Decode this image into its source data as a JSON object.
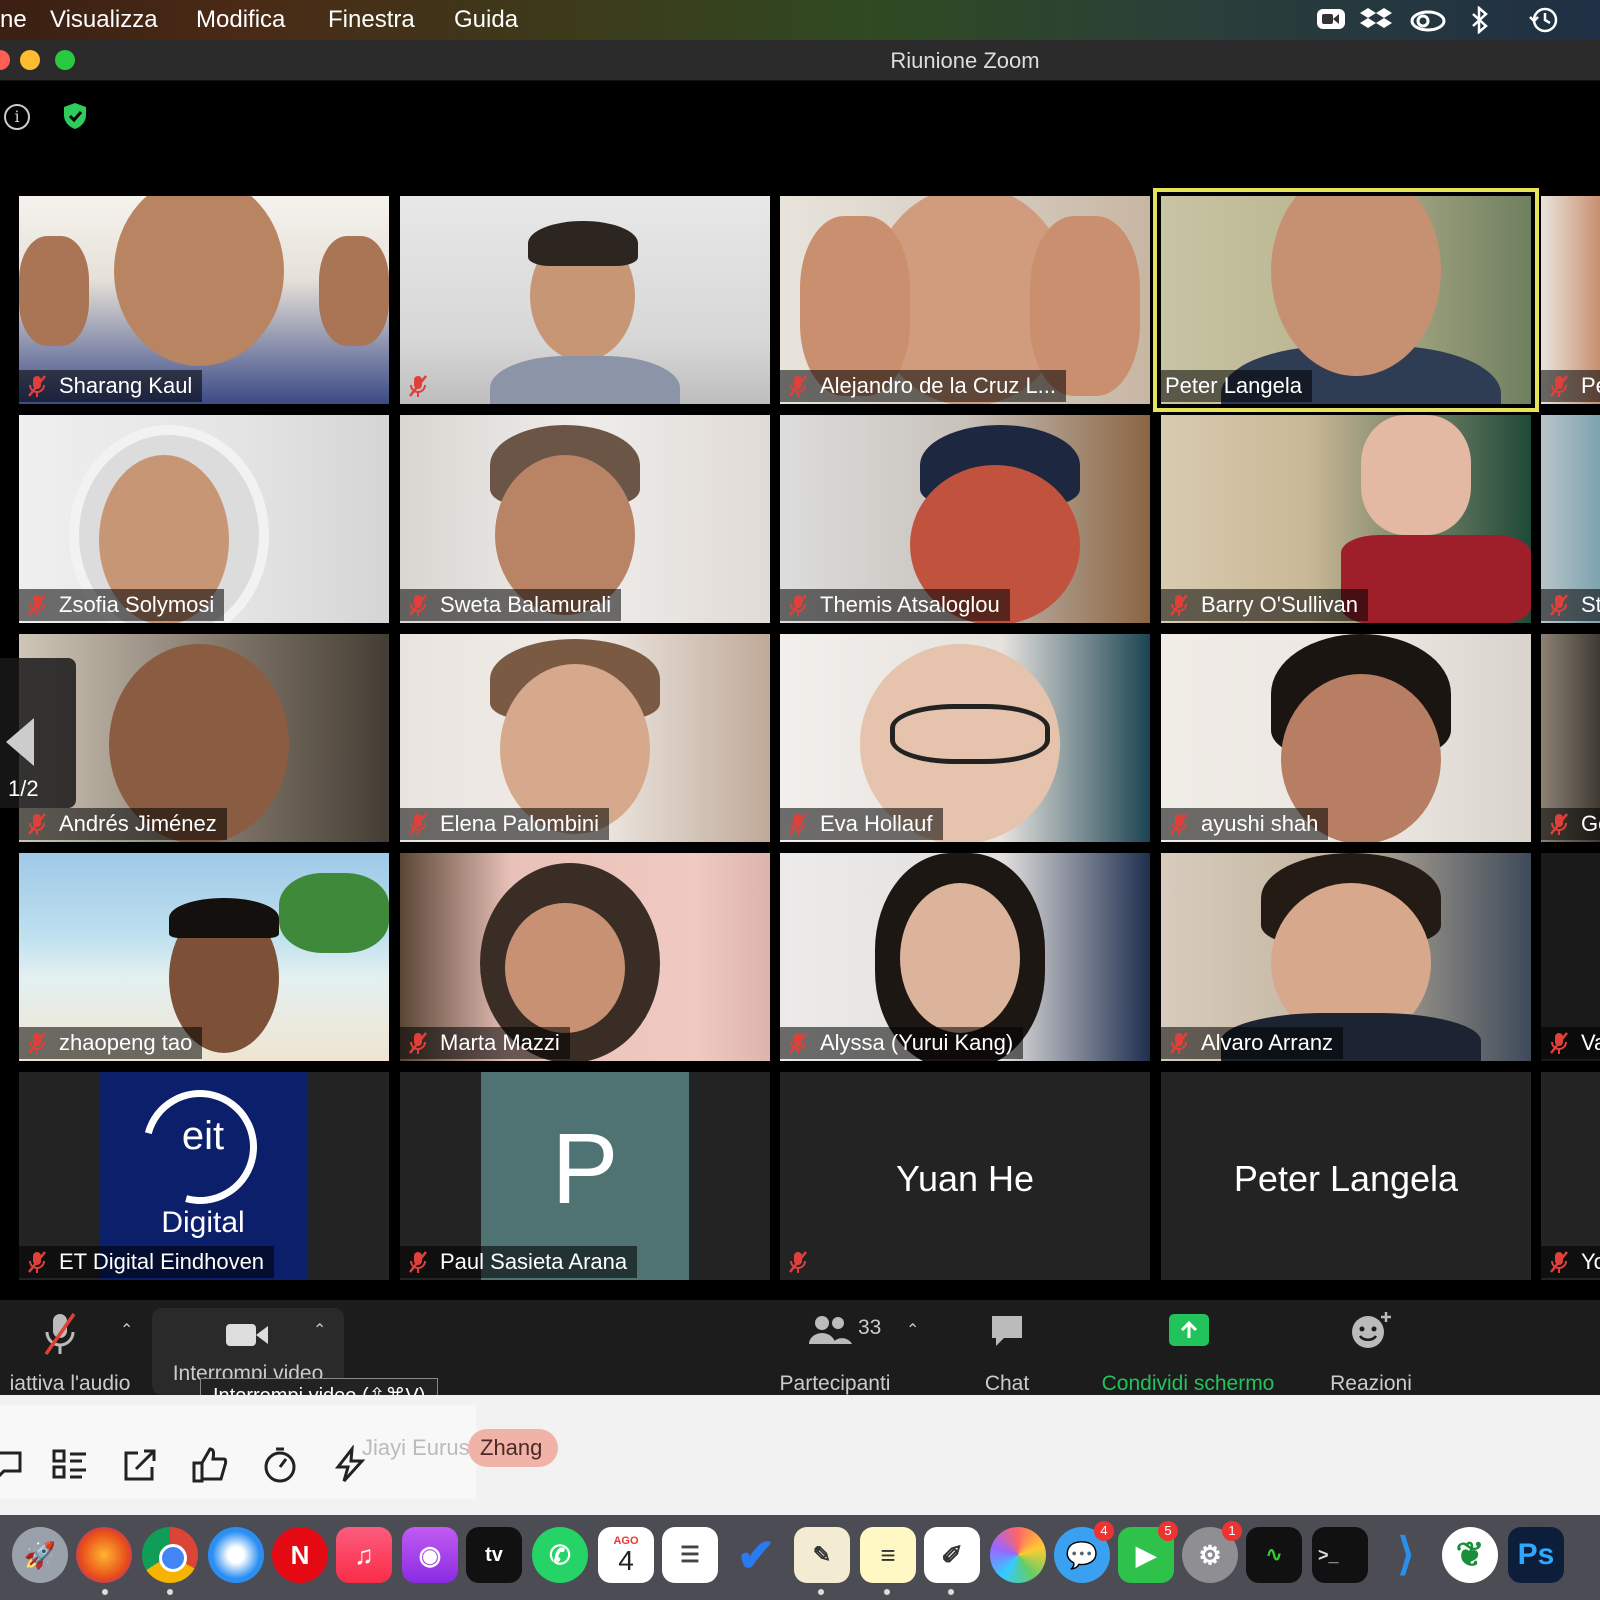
{
  "menubar": {
    "items": [
      "ne",
      "Visualizza",
      "Modifica",
      "Finestra",
      "Guida"
    ]
  },
  "window": {
    "title": "Riunione Zoom"
  },
  "pager": {
    "page": "1/2"
  },
  "tiles": [
    {
      "name": "Sharang Kaul"
    },
    {
      "name": ""
    },
    {
      "name": "Alejandro de la Cruz L..."
    },
    {
      "name": "Peter Langela"
    },
    {
      "name": "Pe"
    },
    {
      "name": "Zsofia Solymosi"
    },
    {
      "name": "Sweta Balamurali"
    },
    {
      "name": "Themis Atsaloglou"
    },
    {
      "name": "Barry O'Sullivan"
    },
    {
      "name": "Ste"
    },
    {
      "name": "Andrés Jiménez"
    },
    {
      "name": "Elena Palombini"
    },
    {
      "name": "Eva Hollauf"
    },
    {
      "name": "ayushi shah"
    },
    {
      "name": "Ge"
    },
    {
      "name": "zhaopeng tao"
    },
    {
      "name": "Marta Mazzi"
    },
    {
      "name": "Alyssa (Yurui Kang)"
    },
    {
      "name": "Alvaro Arranz"
    },
    {
      "name": "Va"
    },
    {
      "name": "ET Digital Eindhoven"
    },
    {
      "name": "Paul Sasieta Arana"
    },
    {
      "name": ""
    },
    {
      "name": ""
    },
    {
      "name": "Yo"
    }
  ],
  "tile_avatars": {
    "eit_logo": "eit",
    "eit_sub": "Digital",
    "paul_initial": "P",
    "yuan_center": "Yuan He",
    "peter_center": "Peter Langela"
  },
  "toolbar": {
    "audio_label": "iattiva l'audio",
    "video_label": "Interrompi video",
    "participants_count": "33",
    "participants_label": "Partecipanti",
    "chat_label": "Chat",
    "share_label": "Condividi schermo",
    "reactions_label": "Reazioni",
    "tooltip": "Interrompi video (⇧⌘V)"
  },
  "lower": {
    "ghost_text": "Jiayi Eurus",
    "pill_text": "Zhang"
  },
  "dock": {
    "calendar_month": "AGO",
    "calendar_day": "4",
    "badges": [
      "4",
      "5",
      "1"
    ],
    "vscode_letter": "Ps"
  },
  "colors": {
    "active_speaker": "#e6e35a",
    "share_green": "#22c35a",
    "muted_red": "#e0403a",
    "toolbar_bg": "#1c1c1c"
  }
}
